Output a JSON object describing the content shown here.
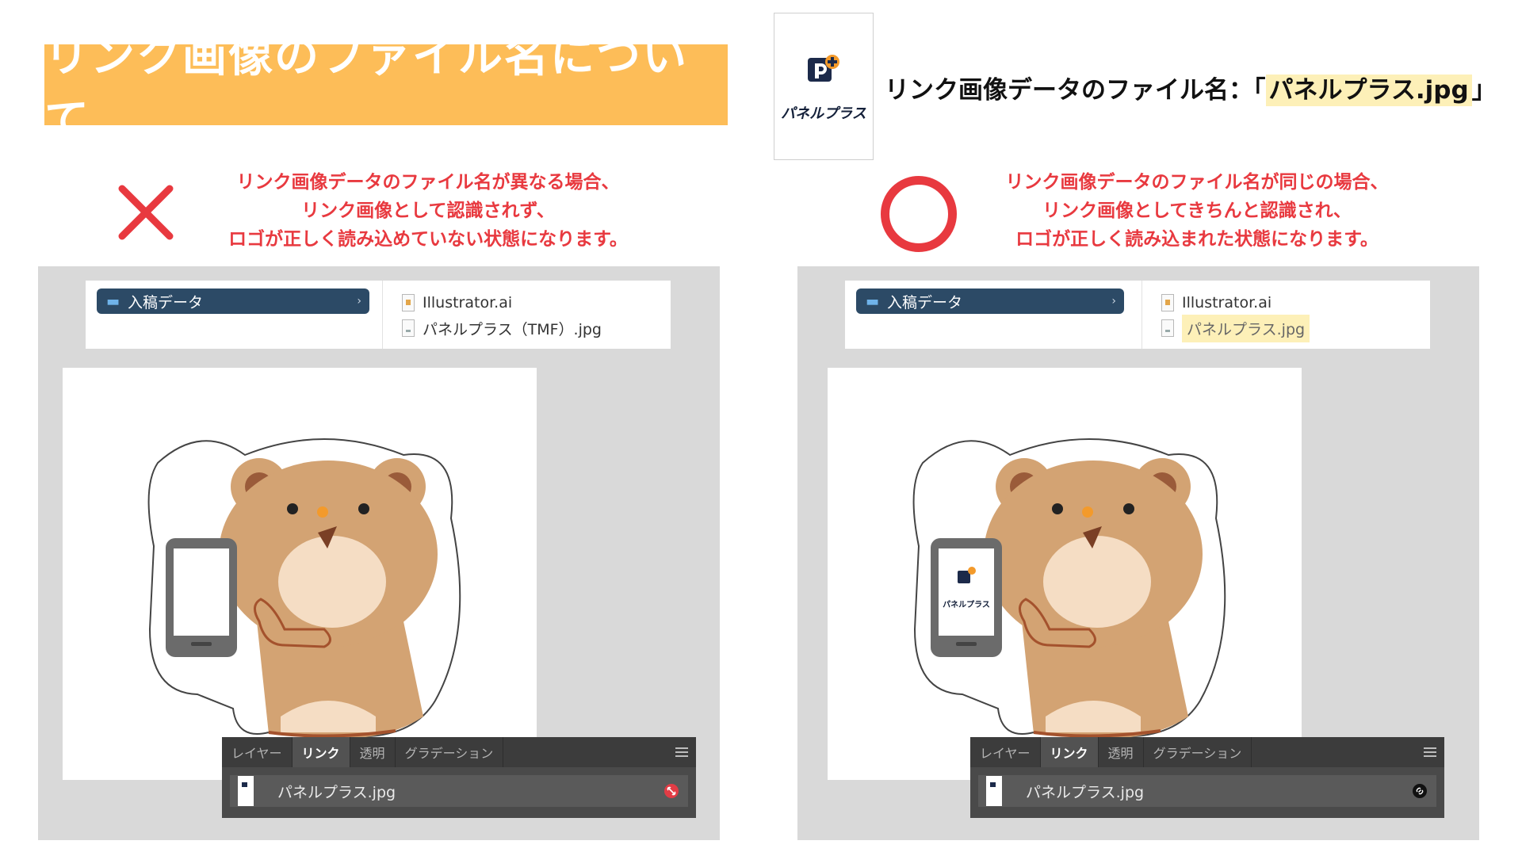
{
  "title": "リンク画像のファイル名について",
  "logo": {
    "text": "パネルプラス"
  },
  "filename_info": {
    "prefix": "リンク画像データのファイル名：「",
    "filename": "パネルプラス.jpg",
    "suffix": "」"
  },
  "colors": {
    "title_bg": "#fdbd58",
    "accent_red": "#e8393f",
    "folder_blue": "#2c4a66",
    "highlight": "#fdf0b8"
  },
  "bad_case": {
    "note_lines": [
      "リンク画像データのファイル名が異なる場合、",
      "リンク画像として認識されず、",
      "ロゴが正しく読み込めていない状態になります。"
    ],
    "finder": {
      "folder": "入稿データ",
      "files": [
        "Illustrator.ai",
        "パネルプラス（TMF）.jpg"
      ]
    },
    "links_panel": {
      "tabs": [
        "レイヤー",
        "リンク",
        "透明",
        "グラデーション"
      ],
      "active_tab": "リンク",
      "link_name": "パネルプラス.jpg",
      "status": "missing-link"
    }
  },
  "good_case": {
    "note_lines": [
      "リンク画像データのファイル名が同じの場合、",
      "リンク画像としてきちんと認識され、",
      "ロゴが正しく読み込まれた状態になります。"
    ],
    "finder": {
      "folder": "入稿データ",
      "files": [
        "Illustrator.ai",
        "パネルプラス.jpg"
      ]
    },
    "phone_logo_text": "パネルプラス",
    "links_panel": {
      "tabs": [
        "レイヤー",
        "リンク",
        "透明",
        "グラデーション"
      ],
      "active_tab": "リンク",
      "link_name": "パネルプラス.jpg",
      "status": "linked"
    }
  }
}
